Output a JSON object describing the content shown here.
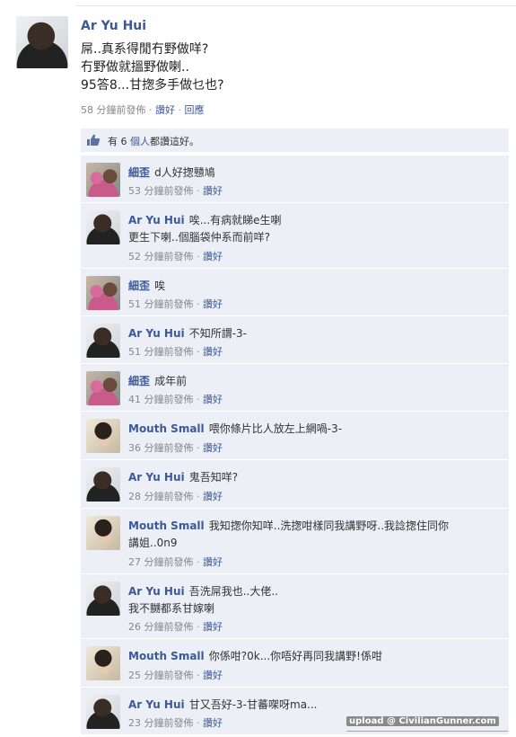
{
  "post": {
    "author": "Ar Yu Hui",
    "body_lines": [
      "屌..真系得閒冇野做咩?",
      "冇野做就搵野做喇..",
      "95答8...甘揔多手做乜也?"
    ],
    "time": "58 分鐘前發佈",
    "like": "讚好",
    "reply": "回應",
    "sep": "·"
  },
  "likes": {
    "prefix": "有 6",
    "count": "個人",
    "suffix": "都讚這好。"
  },
  "comments": [
    {
      "avatar": "sai-icon",
      "name": "細歪",
      "text": "d人好揔戇鳩",
      "time": "53 分鐘前發佈",
      "like": "讚好"
    },
    {
      "avatar": "aryu-icon",
      "name": "Ar Yu Hui",
      "text": "唉...有病就睇e生喇\n更生下喇..個腦袋仲系而前咩?",
      "time": "52 分鐘前發佈",
      "like": "讚好"
    },
    {
      "avatar": "sai-icon",
      "name": "細歪",
      "text": "唉",
      "time": "51 分鐘前發佈",
      "like": "讚好"
    },
    {
      "avatar": "aryu-icon",
      "name": "Ar Yu Hui",
      "text": "不知所謂-3-",
      "time": "51 分鐘前發佈",
      "like": "讚好"
    },
    {
      "avatar": "sai-icon",
      "name": "細歪",
      "text": "成年前",
      "time": "41 分鐘前發佈",
      "like": "讚好"
    },
    {
      "avatar": "mouth-icon",
      "name": "Mouth Small",
      "text": "喂你條片比人放左上網喎-3-",
      "time": "36 分鐘前發佈",
      "like": "讚好"
    },
    {
      "avatar": "aryu-icon",
      "name": "Ar Yu Hui",
      "text": "鬼吾知咩?",
      "time": "28 分鐘前發佈",
      "like": "讚好"
    },
    {
      "avatar": "mouth-icon",
      "name": "Mouth Small",
      "text": "我知揔你知咩..洗揔咁樣同我講野呀..我諗揔住同你\n講姐..0n9",
      "time": "27 分鐘前發佈",
      "like": "讚好"
    },
    {
      "avatar": "aryu-icon",
      "name": "Ar Yu Hui",
      "text": "吾洗屌我也..大佬..\n我不嬲都系甘嫁喇",
      "time": "26 分鐘前發佈",
      "like": "讚好"
    },
    {
      "avatar": "mouth-icon",
      "name": "Mouth Small",
      "text": "你係咁?0k...你唔好再同我講野!係咁",
      "time": "25 分鐘前發佈",
      "like": "讚好"
    },
    {
      "avatar": "aryu-icon",
      "name": "Ar Yu Hui",
      "text": "甘又吾好-3-甘蕃㗎呀ma...",
      "time": "23 分鐘前發佈",
      "like": "讚好"
    }
  ],
  "watermark": "upload @ CivilianGunner.com",
  "colors": {
    "link": "#3b5998",
    "comment_bg": "#eceff5",
    "meta": "#888888"
  }
}
